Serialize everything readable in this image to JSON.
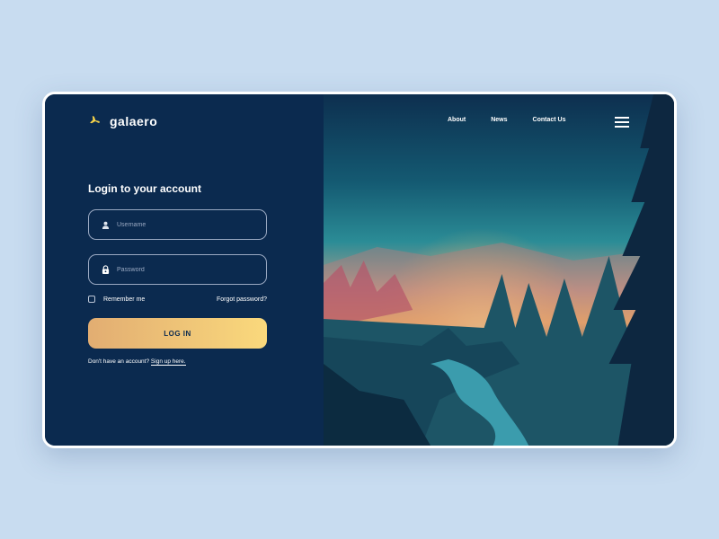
{
  "brand": {
    "name": "galaero",
    "icon": "airplane-icon",
    "accent": "#f5d24a"
  },
  "nav": {
    "items": [
      "About",
      "News",
      "Contact Us"
    ],
    "menu_icon": "hamburger-icon"
  },
  "login": {
    "title": "Login to your account",
    "username_placeholder": "Username",
    "password_placeholder": "Password",
    "remember": "Remember me",
    "forgot": "Forgot password?",
    "button": "LOG IN",
    "signup_prompt": "Don't have an account?",
    "signup_link": "Sign up here."
  }
}
